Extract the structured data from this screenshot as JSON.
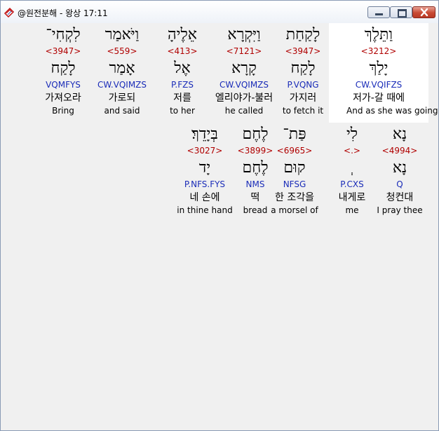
{
  "window": {
    "title": "@원전분해 - 왕상 17:11",
    "icon": "bible-app-icon"
  },
  "colors": {
    "strong_number": "#b00000",
    "parsing": "#1a2cb8",
    "selected_background": "#ffffff",
    "panel_background": "#f0f0f0"
  },
  "row1": [
    {
      "hebrew": "וַתֵּלֶךְ",
      "strong": "<3212>",
      "lemma": "יָלַךְ",
      "parse": "CW.VQIFZS",
      "korean": "저가-갈 때에",
      "english": "And as she was going"
    },
    {
      "hebrew": "לָקַחַת",
      "strong": "<3947>",
      "lemma": "לָקַח",
      "parse": "P.VQNG",
      "korean": "가지러",
      "english": "to fetch it"
    },
    {
      "hebrew": "וַיִּקְרָא",
      "strong": "<7121>",
      "lemma": "קָרָא",
      "parse": "CW.VQIMZS",
      "korean": "엘리야가-불러",
      "english": "he called"
    },
    {
      "hebrew": "אֵלֶיהָ",
      "strong": "<413>",
      "lemma": "אֶל",
      "parse": "P.FZS",
      "korean": "저를",
      "english": "to her"
    },
    {
      "hebrew": "וַיֹּאמַר",
      "strong": "<559>",
      "lemma": "אָמַר",
      "parse": "CW.VQIMZS",
      "korean": "가로되",
      "english": "and said"
    },
    {
      "hebrew": "לִקְחִי־",
      "strong": "<3947>",
      "lemma": "לָקַח",
      "parse": "VQMFYS",
      "korean": "가져오라",
      "english": "Bring"
    }
  ],
  "row2": [
    {
      "hebrew": "נָא",
      "strong": "<4994>",
      "lemma": "נָא",
      "parse": "Q",
      "korean": "청컨대",
      "english": "I pray thee"
    },
    {
      "hebrew": "לִי",
      "strong": "<.>",
      "lemma": "ְ",
      "parse": "P.CXS",
      "korean": "내게로",
      "english": "me"
    },
    {
      "hebrew": "פַּת־",
      "strong": "<6965>",
      "lemma": "קוּם",
      "parse": "NFSG",
      "korean": "한 조각을",
      "english": "a morsel of"
    },
    {
      "hebrew": "לֶחֶם",
      "strong": "<3899>",
      "lemma": "לֶחֶם",
      "parse": "NMS",
      "korean": "떡",
      "english": "bread"
    },
    {
      "hebrew": "בְּיָדֵךְ׃",
      "strong": "<3027>",
      "lemma": "יָד",
      "parse": "P.NFS.FYS",
      "korean": "네 손에",
      "english": "in thine hand"
    }
  ]
}
